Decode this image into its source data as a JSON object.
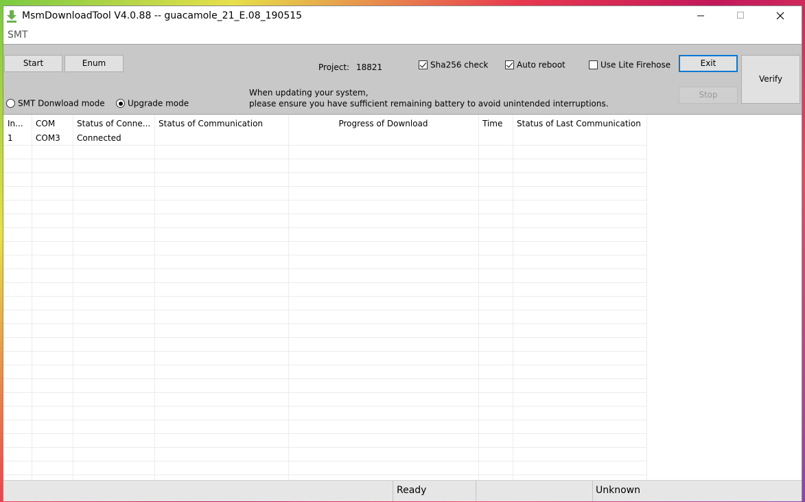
{
  "window": {
    "title": "MsmDownloadTool V4.0.88 -- guacamole_21_E.08_190515",
    "menu": "SMT"
  },
  "toolbar": {
    "start_label": "Start",
    "enum_label": "Enum",
    "project_label": "Project:",
    "project_value": "18821",
    "sha256_label": "Sha256 check",
    "sha256_checked": true,
    "auto_reboot_label": "Auto reboot",
    "auto_reboot_checked": true,
    "lite_firehose_label": "Use Lite Firehose",
    "lite_firehose_checked": false,
    "exit_label": "Exit",
    "stop_label": "Stop",
    "verify_label": "Verify",
    "smt_mode_label": "SMT Donwload mode",
    "upgrade_mode_label": "Upgrade mode",
    "selected_mode": "upgrade",
    "notice_line1": "When updating your system,",
    "notice_line2": "please ensure you have sufficient remaining battery to avoid unintended interruptions."
  },
  "table": {
    "columns": [
      "In...",
      "COM",
      "Status of Conne...",
      "Status of Communication",
      "Progress of Download",
      "Time",
      "Status of Last Communication"
    ],
    "rows": [
      [
        "1",
        "COM3",
        "Connected",
        "",
        "",
        "",
        ""
      ]
    ]
  },
  "statusbar": {
    "status": "Ready",
    "state": "Unknown"
  }
}
